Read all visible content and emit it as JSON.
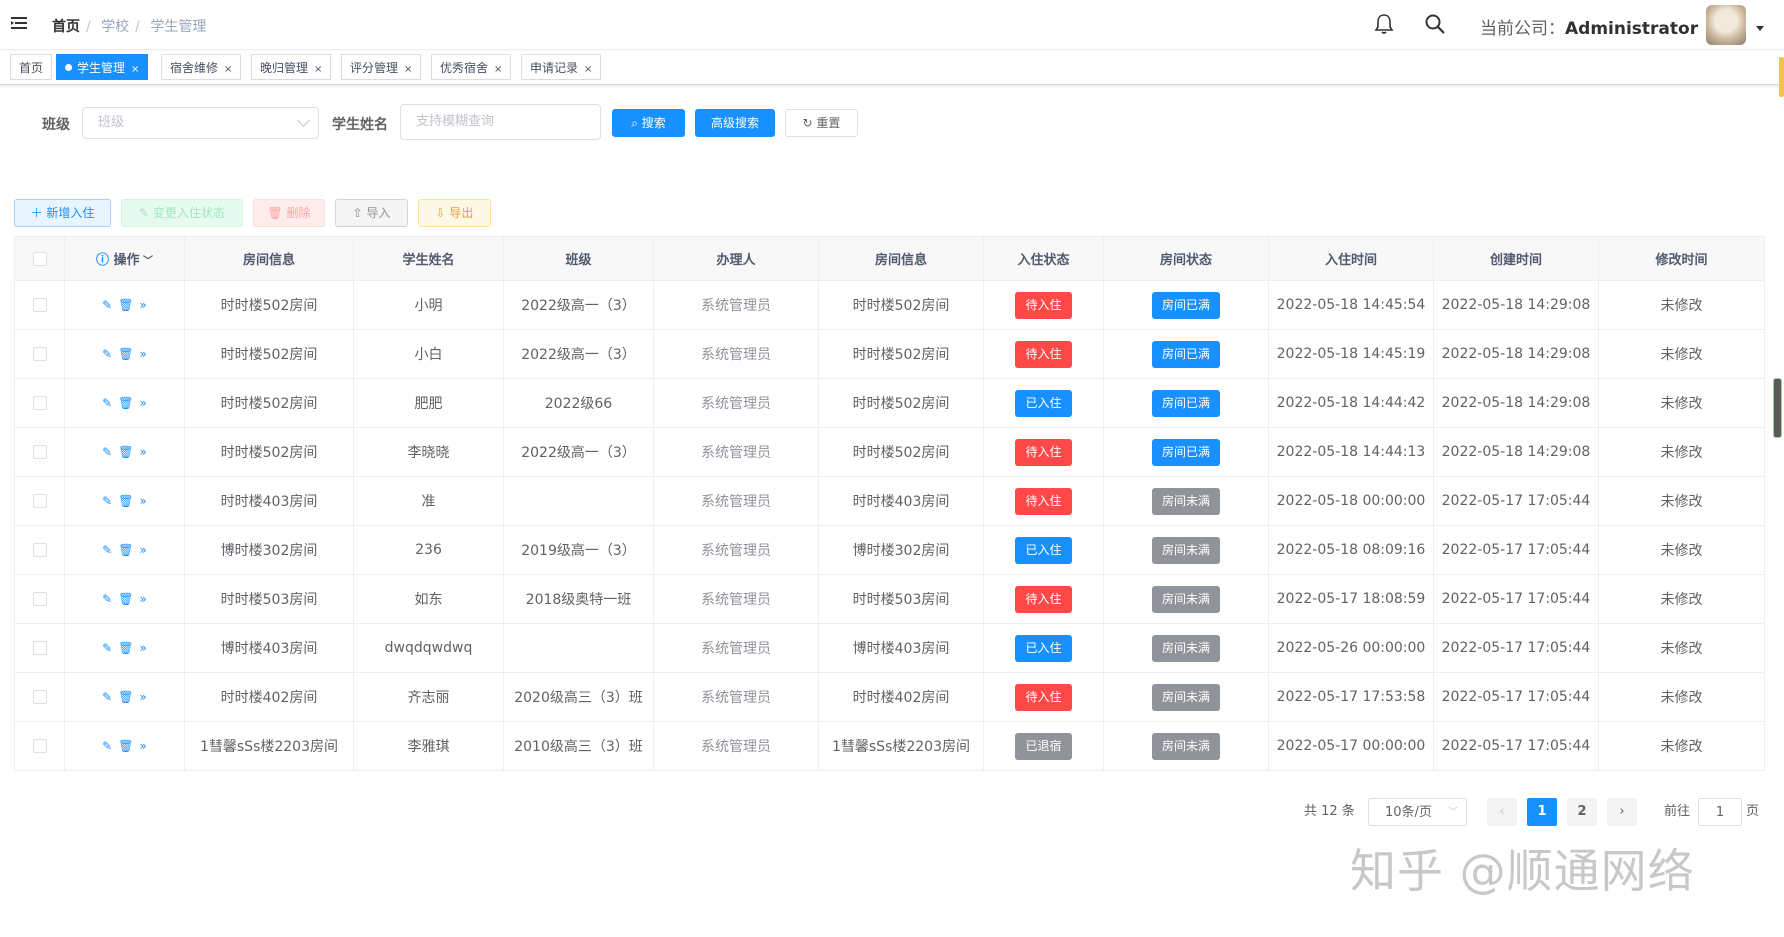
{
  "breadcrumb": [
    "首页",
    "学校",
    "学生管理"
  ],
  "breadcrumb_sep": "/",
  "navbar": {
    "company_label": "当前公司：",
    "company_name": "Administrator"
  },
  "tabs": [
    {
      "label": "首页",
      "active": false,
      "closable": false
    },
    {
      "label": "学生管理",
      "active": true,
      "closable": true
    },
    {
      "label": "宿舍维修",
      "active": false,
      "closable": true
    },
    {
      "label": "晚归管理",
      "active": false,
      "closable": true
    },
    {
      "label": "评分管理",
      "active": false,
      "closable": true
    },
    {
      "label": "优秀宿舍",
      "active": false,
      "closable": true
    },
    {
      "label": "申请记录",
      "active": false,
      "closable": true
    }
  ],
  "tab_close": "×",
  "search": {
    "class_label": "班级",
    "class_placeholder": "班级",
    "name_label": "学生姓名",
    "name_placeholder": "支持模糊查询",
    "search_btn": "搜索",
    "advanced_btn": "高级搜索",
    "reset_btn": "重置"
  },
  "toolbar": {
    "add": "新增入住",
    "change": "变更入住状态",
    "delete": "删除",
    "import": "导入",
    "export": "导出"
  },
  "table": {
    "headers": [
      "操作",
      "房间信息",
      "学生姓名",
      "班级",
      "办理人",
      "房间信息",
      "入住状态",
      "房间状态",
      "入住时间",
      "创建时间",
      "修改时间"
    ],
    "rows": [
      {
        "room": "时时楼502房间",
        "name": "小明",
        "class": "2022级高一（3）",
        "handler": "系统管理员",
        "room2": "时时楼502房间",
        "status": "待入住",
        "room_status": "房间已满",
        "checkin": "2022-05-18 14:45:54",
        "created": "2022-05-18 14:29:08",
        "modified": "未修改"
      },
      {
        "room": "时时楼502房间",
        "name": "小白",
        "class": "2022级高一（3）",
        "handler": "系统管理员",
        "room2": "时时楼502房间",
        "status": "待入住",
        "room_status": "房间已满",
        "checkin": "2022-05-18 14:45:19",
        "created": "2022-05-18 14:29:08",
        "modified": "未修改"
      },
      {
        "room": "时时楼502房间",
        "name": "肥肥",
        "class": "2022级66",
        "handler": "系统管理员",
        "room2": "时时楼502房间",
        "status": "已入住",
        "room_status": "房间已满",
        "checkin": "2022-05-18 14:44:42",
        "created": "2022-05-18 14:29:08",
        "modified": "未修改"
      },
      {
        "room": "时时楼502房间",
        "name": "李晓晓",
        "class": "2022级高一（3）",
        "handler": "系统管理员",
        "room2": "时时楼502房间",
        "status": "待入住",
        "room_status": "房间已满",
        "checkin": "2022-05-18 14:44:13",
        "created": "2022-05-18 14:29:08",
        "modified": "未修改"
      },
      {
        "room": "时时楼403房间",
        "name": "准",
        "class": "",
        "handler": "系统管理员",
        "room2": "时时楼403房间",
        "status": "待入住",
        "room_status": "房间未满",
        "checkin": "2022-05-18 00:00:00",
        "created": "2022-05-17 17:05:44",
        "modified": "未修改"
      },
      {
        "room": "博时楼302房间",
        "name": "236",
        "class": "2019级高一（3）",
        "handler": "系统管理员",
        "room2": "博时楼302房间",
        "status": "已入住",
        "room_status": "房间未满",
        "checkin": "2022-05-18 08:09:16",
        "created": "2022-05-17 17:05:44",
        "modified": "未修改"
      },
      {
        "room": "时时楼503房间",
        "name": "如东",
        "class": "2018级奥特一班",
        "handler": "系统管理员",
        "room2": "时时楼503房间",
        "status": "待入住",
        "room_status": "房间未满",
        "checkin": "2022-05-17 18:08:59",
        "created": "2022-05-17 17:05:44",
        "modified": "未修改"
      },
      {
        "room": "博时楼403房间",
        "name": "dwqdqwdwq",
        "class": "",
        "handler": "系统管理员",
        "room2": "博时楼403房间",
        "status": "已入住",
        "room_status": "房间未满",
        "checkin": "2022-05-26 00:00:00",
        "created": "2022-05-17 17:05:44",
        "modified": "未修改"
      },
      {
        "room": "时时楼402房间",
        "name": "齐志丽",
        "class": "2020级高三（3）班",
        "handler": "系统管理员",
        "room2": "时时楼402房间",
        "status": "待入住",
        "room_status": "房间未满",
        "checkin": "2022-05-17 17:53:58",
        "created": "2022-05-17 17:05:44",
        "modified": "未修改"
      },
      {
        "room": "1彗馨sSs楼2203房间",
        "name": "李雅琪",
        "class": "2010级高三（3）班",
        "handler": "系统管理员",
        "room2": "1彗馨sSs楼2203房间",
        "status": "已退宿",
        "room_status": "房间未满",
        "checkin": "2022-05-17 00:00:00",
        "created": "2022-05-17 17:05:44",
        "modified": "未修改"
      }
    ]
  },
  "pagination": {
    "total": "共 12 条",
    "page_size": "10条/页",
    "pages": [
      "1",
      "2"
    ],
    "current": "1",
    "goto_label": "前往",
    "goto_value": "1",
    "page_suffix": "页"
  },
  "watermark": "知乎 @顺通网络",
  "colors": {
    "primary": "#1890ff",
    "danger": "#ff4949",
    "info": "#909399"
  }
}
